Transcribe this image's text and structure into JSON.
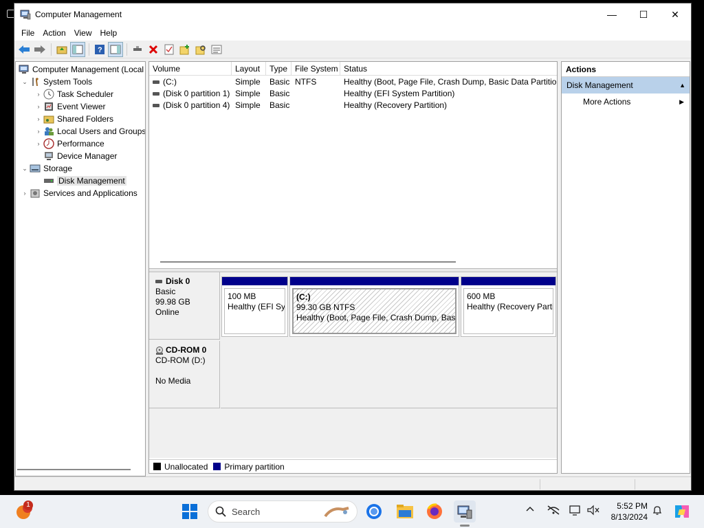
{
  "window": {
    "title": "Computer Management",
    "controls": {
      "minimize": "—",
      "maximize": "☐",
      "close": "✕"
    }
  },
  "menu": [
    "File",
    "Action",
    "View",
    "Help"
  ],
  "tree": {
    "root": "Computer Management (Local",
    "system_tools": "System Tools",
    "task_scheduler": "Task Scheduler",
    "event_viewer": "Event Viewer",
    "shared_folders": "Shared Folders",
    "local_users": "Local Users and Groups",
    "performance": "Performance",
    "device_manager": "Device Manager",
    "storage": "Storage",
    "disk_management": "Disk Management",
    "services": "Services and Applications"
  },
  "volume_list": {
    "columns": [
      "Volume",
      "Layout",
      "Type",
      "File System",
      "Status"
    ],
    "rows": [
      {
        "volume": "(C:)",
        "layout": "Simple",
        "type": "Basic",
        "fs": "NTFS",
        "status": "Healthy (Boot, Page File, Crash Dump, Basic Data Partition)"
      },
      {
        "volume": "(Disk 0 partition 1)",
        "layout": "Simple",
        "type": "Basic",
        "fs": "",
        "status": "Healthy (EFI System Partition)"
      },
      {
        "volume": "(Disk 0 partition 4)",
        "layout": "Simple",
        "type": "Basic",
        "fs": "",
        "status": "Healthy (Recovery Partition)"
      }
    ]
  },
  "disks": {
    "disk0": {
      "name": "Disk 0",
      "type": "Basic",
      "size": "99.98 GB",
      "state": "Online",
      "partitions": [
        {
          "title": "",
          "size": "100 MB",
          "status": "Healthy (EFI Sys"
        },
        {
          "title": "(C:)",
          "size": "99.30 GB NTFS",
          "status": "Healthy (Boot, Page File, Crash Dump, Basic"
        },
        {
          "title": "",
          "size": "600 MB",
          "status": "Healthy (Recovery Partit"
        }
      ]
    },
    "cdrom0": {
      "name": "CD-ROM 0",
      "drive": "CD-ROM (D:)",
      "media": "No Media"
    }
  },
  "legend": {
    "unallocated": "Unallocated",
    "primary": "Primary partition",
    "unallocated_color": "#000000",
    "primary_color": "#00008b"
  },
  "actions": {
    "header": "Actions",
    "section": "Disk Management",
    "more": "More Actions"
  },
  "taskbar": {
    "search_placeholder": "Search",
    "notification_badge": "1",
    "time": "5:52 PM",
    "date": "8/13/2024"
  }
}
